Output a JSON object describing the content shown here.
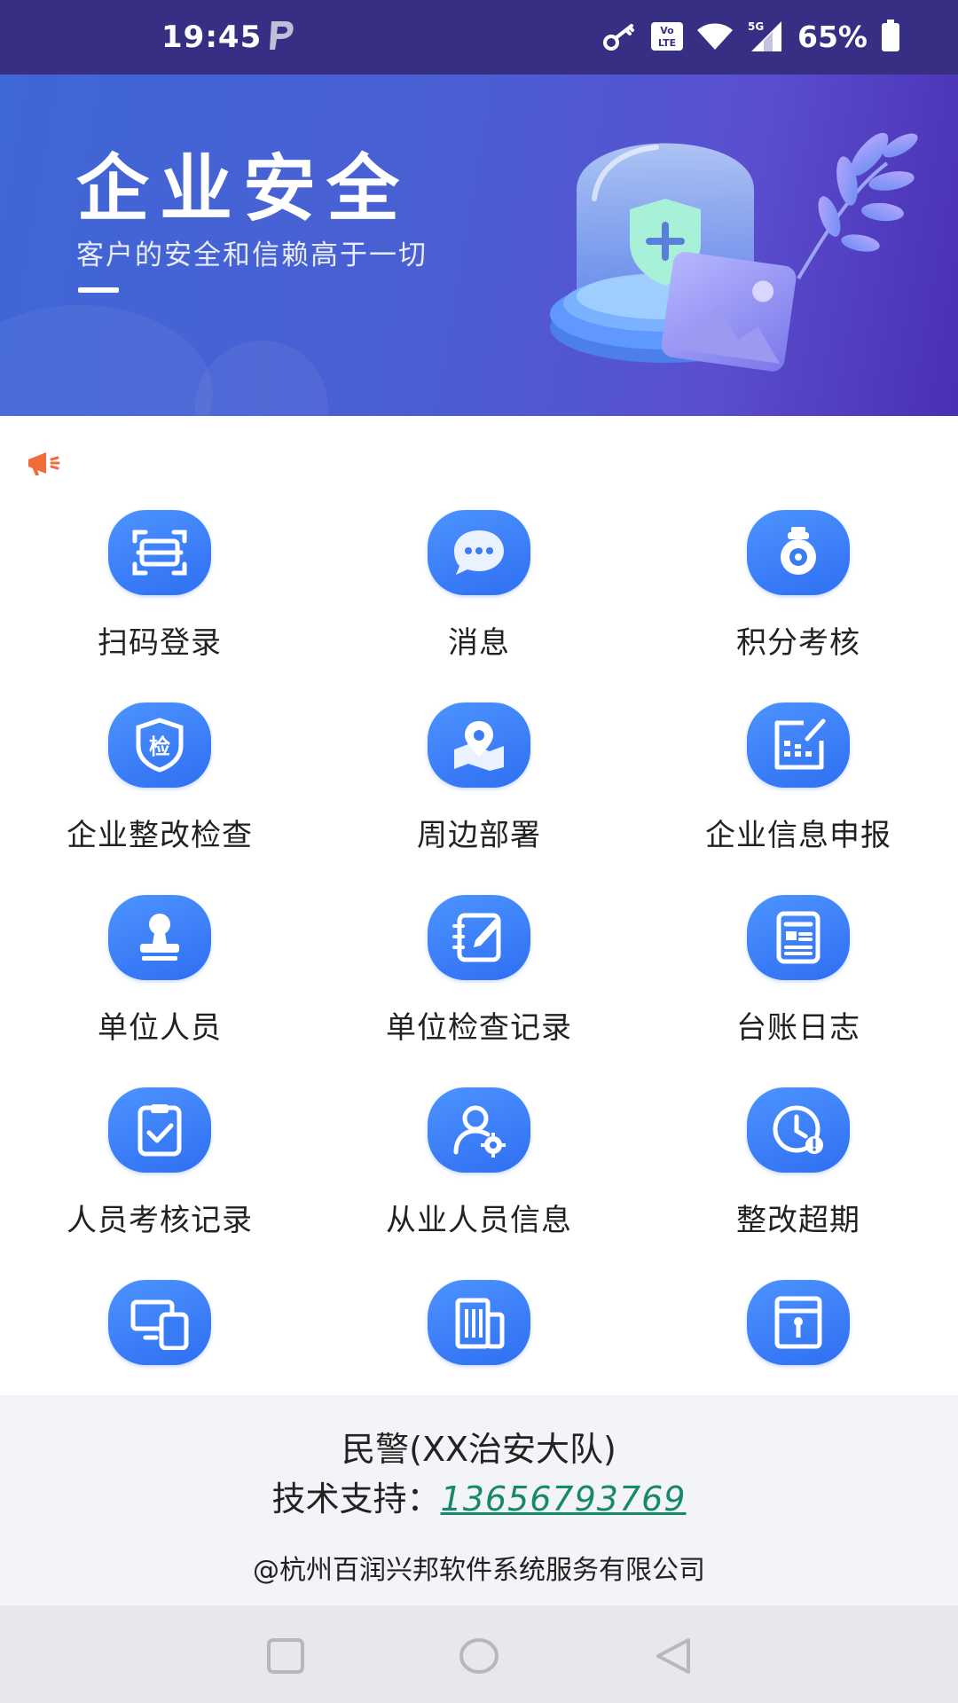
{
  "status_bar": {
    "time": "19:45",
    "battery": "65%",
    "icons": [
      "parking-p-icon",
      "key-icon",
      "volte-icon",
      "wifi-icon",
      "5g-signal-icon",
      "battery-icon"
    ]
  },
  "banner": {
    "title": "企业安全",
    "subtitle": "客户的安全和信赖高于一切"
  },
  "notice": {
    "icon": "megaphone-icon"
  },
  "grid": {
    "items": [
      {
        "label": "扫码登录",
        "icon": "scan-icon"
      },
      {
        "label": "消息",
        "icon": "message-icon"
      },
      {
        "label": "积分考核",
        "icon": "camera-medal-icon"
      },
      {
        "label": "企业整改检查",
        "icon": "inspection-shield-icon"
      },
      {
        "label": "周边部署",
        "icon": "map-pin-icon"
      },
      {
        "label": "企业信息申报",
        "icon": "report-chart-icon"
      },
      {
        "label": "单位人员",
        "icon": "stamp-icon"
      },
      {
        "label": "单位检查记录",
        "icon": "notebook-pen-icon"
      },
      {
        "label": "台账日志",
        "icon": "ledger-icon"
      },
      {
        "label": "人员考核记录",
        "icon": "clipboard-check-icon"
      },
      {
        "label": "从业人员信息",
        "icon": "user-gear-icon"
      },
      {
        "label": "整改超期",
        "icon": "clock-alert-icon"
      },
      {
        "label": "",
        "icon": "devices-icon"
      },
      {
        "label": "",
        "icon": "building-icon"
      },
      {
        "label": "",
        "icon": "cabinet-icon"
      }
    ]
  },
  "footer": {
    "org": "民警(XX治安大队)",
    "support_label": "技术支持：",
    "phone": "13656793769",
    "company": "@杭州百润兴邦软件系统服务有限公司"
  },
  "nav_bar": {
    "buttons": [
      "recents-square-icon",
      "home-circle-icon",
      "back-triangle-icon"
    ]
  },
  "colors": {
    "status_bar_bg": "#372f83",
    "icon_tile": "#3a7cf5",
    "phone_link": "#16886b",
    "footer_bg": "#f3f4f8",
    "nav_bg": "#e8e8ec"
  }
}
